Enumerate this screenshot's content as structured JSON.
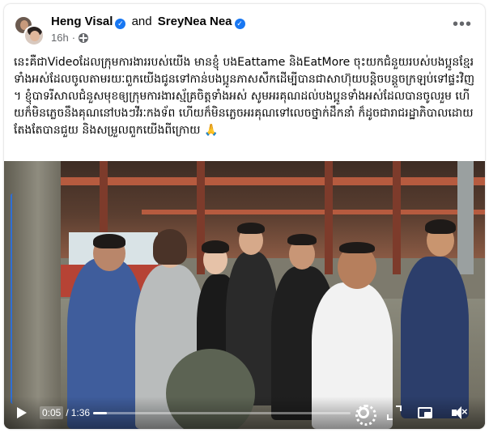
{
  "post": {
    "author_1": "Heng Visal",
    "and_text": "and",
    "author_2": "SreyNea Nea",
    "time": "16h",
    "audience_icon": "globe-icon",
    "more_icon": "more-options-icon",
    "caption": "នេះគឺជាVideoដែលក្រុមការងាររបស់យើង មានខ្ញុំ បងEattame និងEatMore ចុះយកជំនួយរបស់បងប្អូនខ្មែរទាំងអស់ដែលចូលតាមរយៈពួកយើងជូនទៅកាន់បងប្អូនភាសសឹកដើម្បីបានជាសាហ៊ុយបន្តិចបន្តួចក្រឡប់ទៅផ្ទះវិញ។ ខ្ញុំបាទរីសាលជំនួសមុខឲ្យក្រុមការងារស្ម័គ្រចិត្តទាំងអស់ សូមអរគុណដល់បងប្អូនទាំងអស់ដែលបានចូលរួម ហើយក៏មិនភ្លេចនឹងគុណនៅបងៗវីរៈកងទ័ព ហើយក៏មិនភ្លេចអរគុណទៅលេចថ្នាក់ដឹកនាំ ក៏ដូចជារាជរដ្ឋាភិបាលដោយតែងតែបានជួយ និងសម្រួលពួកយើងពីក្រោយ 🙏"
  },
  "video": {
    "current_time": "0:05",
    "separator": "/",
    "duration": "1:36",
    "progress_fraction": 0.052,
    "controls": {
      "play_icon": "play-icon",
      "settings_icon": "settings-gear-icon",
      "fullscreen_icon": "expand-icon",
      "pip_icon": "picture-in-picture-icon",
      "volume_icon": "muted-speaker-icon"
    }
  },
  "colors": {
    "verified_badge": "#1877f2",
    "secondary_text": "#65676b"
  }
}
